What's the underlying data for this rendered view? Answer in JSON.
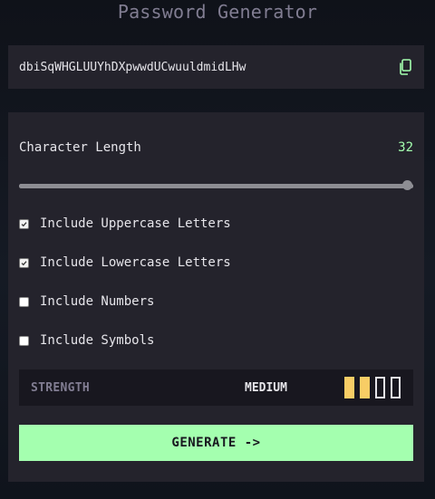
{
  "app": {
    "title": "Password Generator"
  },
  "password": {
    "value": "dbiSqWHGLUUYhDXpwwdUCwuuldmidLHw",
    "copy_icon": "copy-icon"
  },
  "length": {
    "label": "Character Length",
    "value": "32",
    "slider_fraction": 1.0
  },
  "options": [
    {
      "label": "Include Uppercase Letters",
      "checked": true
    },
    {
      "label": "Include Lowercase Letters",
      "checked": true
    },
    {
      "label": "Include Numbers",
      "checked": false
    },
    {
      "label": "Include Symbols",
      "checked": false
    }
  ],
  "strength": {
    "label": "STRENGTH",
    "value": "MEDIUM",
    "level": 2,
    "max_level": 4
  },
  "generate": {
    "label": "GENERATE ->"
  },
  "colors": {
    "accent": "#a4ffaf",
    "panel": "#24232c",
    "strength_fill": "#f8cd65",
    "muted": "#817d92"
  }
}
